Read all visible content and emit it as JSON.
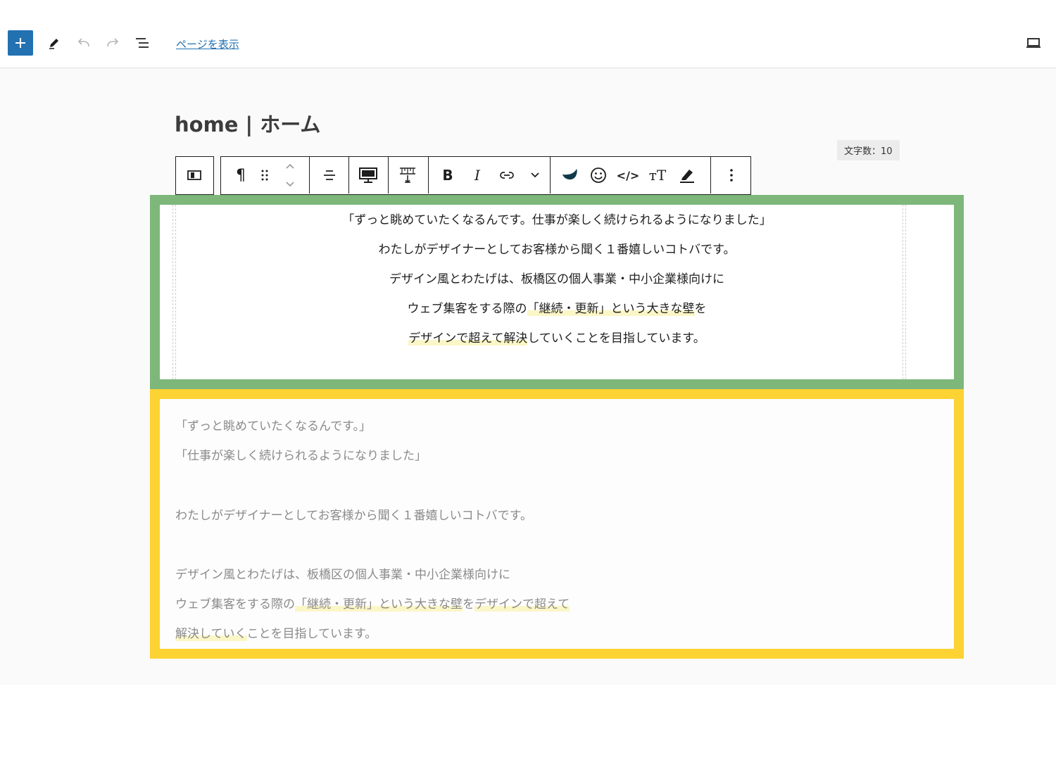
{
  "topbar": {
    "inserter_icon": "plus-icon",
    "tools_icon": "pencil-icon",
    "undo_icon": "undo-icon",
    "redo_icon": "redo-icon",
    "list_view_icon": "list-view-icon",
    "view_page_label": "ページを表示",
    "preview_icon": "laptop-icon"
  },
  "editor": {
    "page_title": "home | ホーム",
    "word_count": "文字数：10"
  },
  "block_toolbar": {
    "icons": [
      "block-type-icon",
      "paragraph-icon",
      "drag-handle-icon",
      "move-up-icon",
      "move-down-icon",
      "align-center-icon",
      "desktop-visibility-icon",
      "spacing-icon",
      "bold-icon",
      "italic-icon",
      "link-icon",
      "more-formats-icon",
      "ink-drop-icon",
      "emoji-icon",
      "code-icon",
      "font-size-icon",
      "highlighter-icon",
      "options-icon"
    ],
    "bold_glyph": "B",
    "italic_glyph": "I",
    "fontsize_glyph": "тT",
    "code_glyph": "</>",
    "paragraph_glyph": "¶"
  },
  "selected_block": {
    "lines": [
      "「ずっと眺めていたくなるんです。仕事が楽しく続けられるようになりました」",
      "わたしがデザイナーとしてお客様から聞く１番嬉しいコトバです。",
      "デザイン風とわたげは、板橋区の個人事業・中小企業様向けに",
      "ウェブ集客をする際の",
      "「継続・更新」という大きな壁",
      "を",
      "デザインで超えて解決",
      "していくことを目指しています。"
    ]
  },
  "original_block": {
    "lines": [
      "「ずっと眺めていたくなるんです。」",
      "「仕事が楽しく続けられるようになりました」",
      "わたしがデザイナーとしてお客様から聞く１番嬉しいコトバです。",
      "デザイン風とわたげは、板橋区の個人事業・中小企業様向けに",
      "ウェブ集客をする際の",
      "「継続・更新」という大きな壁",
      "を",
      "デザインで超えて",
      "解決していく",
      "ことを目指しています。"
    ]
  },
  "colors": {
    "accent": "#2271b1",
    "green_frame": "#7db77a",
    "yellow_frame": "#fdd233",
    "highlight": "#fbf6c6"
  }
}
